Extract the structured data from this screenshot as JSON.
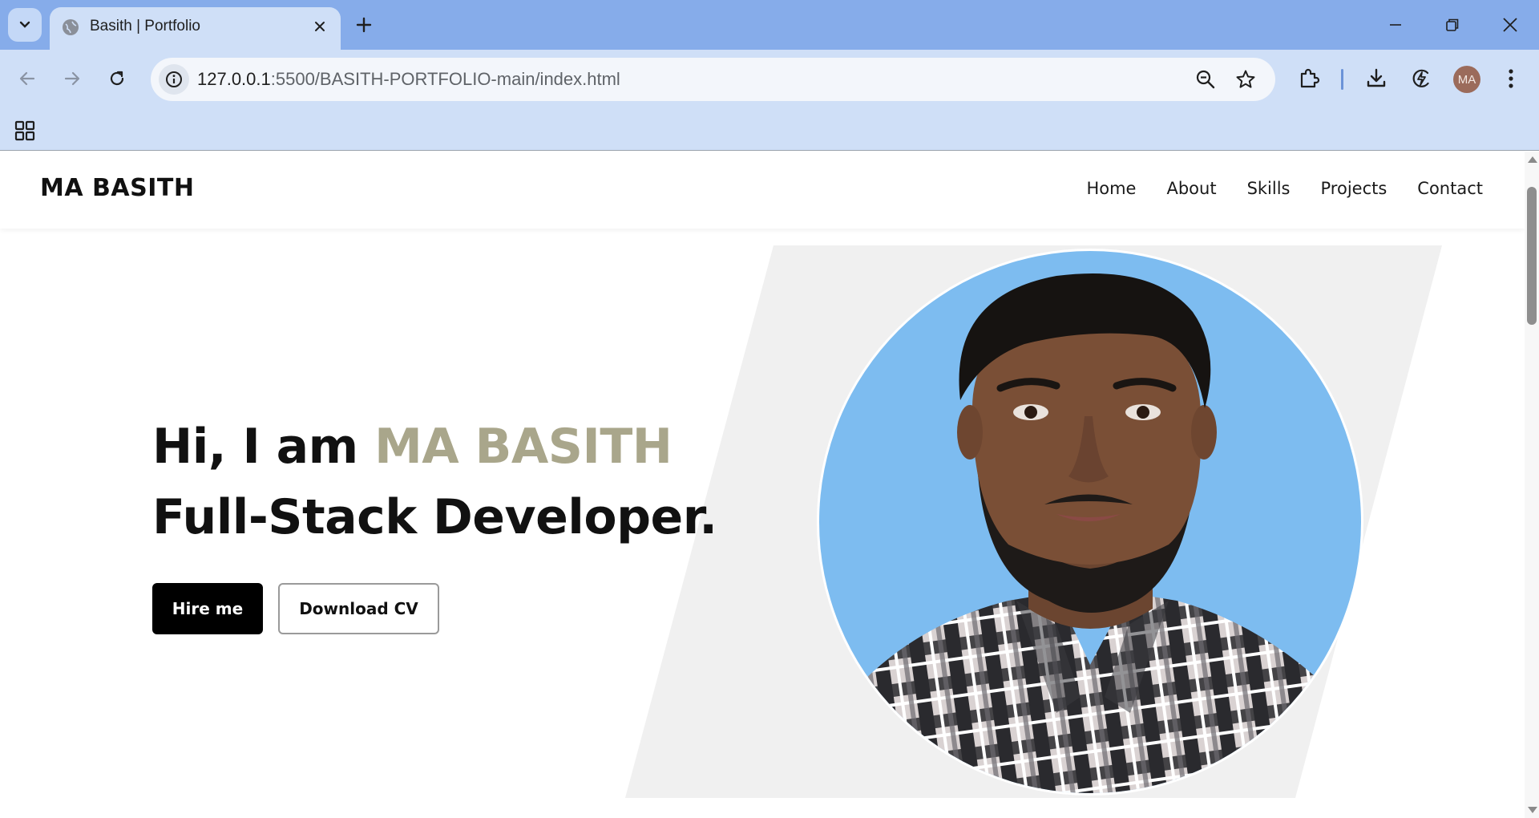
{
  "browser": {
    "tab": {
      "title": "Basith | Portfolio",
      "favicon": "globe-icon"
    },
    "address": {
      "host": "127.0.0.1",
      "path": ":5500/BASITH-PORTFOLIO-main/index.html"
    },
    "profile_initials": "MA",
    "colors": {
      "tabbar": "#86acea",
      "toolbar": "#cfdff7"
    }
  },
  "site": {
    "logo": "MA BASITH",
    "nav": [
      "Home",
      "About",
      "Skills",
      "Projects",
      "Contact"
    ],
    "hero": {
      "greeting": "Hi, I am ",
      "name": "MA BASITH",
      "role": "Full-Stack Developer.",
      "primary_button": "Hire me",
      "secondary_button": "Download CV"
    },
    "colors": {
      "accent": "#a9a68b",
      "text": "#111111",
      "portrait_bg": "#7dbcf0",
      "parallelogram": "#f0f0f0"
    }
  }
}
